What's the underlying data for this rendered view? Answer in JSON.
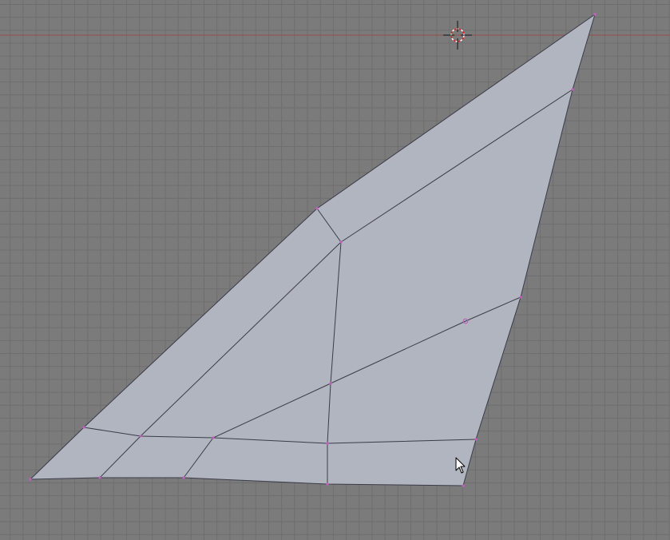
{
  "viewport": {
    "mode": "edit-mode-3d-view",
    "background_color": "#7b7b7b",
    "grid_color": "#6e6e6e",
    "axis_line_color": "#9a4e4e",
    "face_color": "#b1b5bf",
    "edge_color": "#3b3b4a",
    "vertex_color": "#c55fbf",
    "selected_vertex_count": 0
  },
  "icons": {
    "cursor3d": "3d-cursor-icon",
    "pointer": "mouse-pointer-icon"
  }
}
